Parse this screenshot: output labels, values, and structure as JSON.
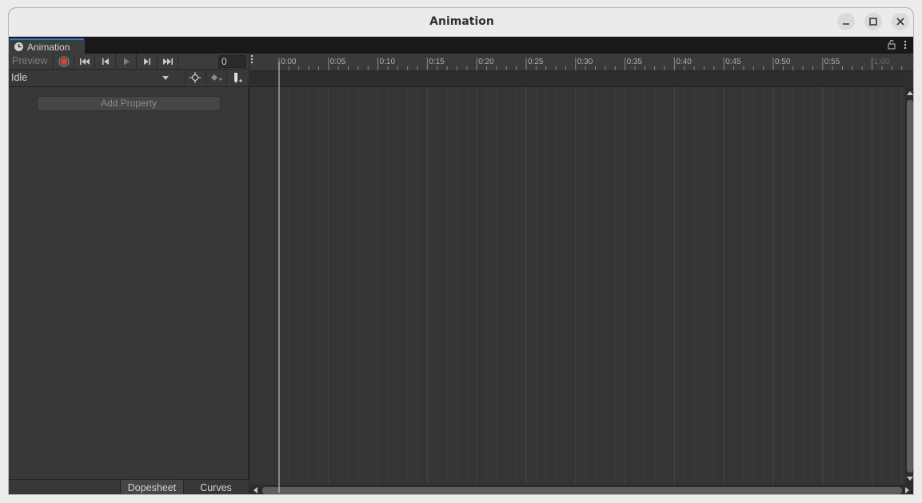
{
  "window": {
    "title": "Animation",
    "controls": [
      "minimize-icon",
      "maximize-icon",
      "close-icon"
    ]
  },
  "tab": {
    "label": "Animation",
    "icon": "clock-icon",
    "actions": [
      "lock-icon",
      "kebab-menu-icon"
    ]
  },
  "toolbar": {
    "preview_label": "Preview",
    "buttons": [
      "record-icon",
      "first-keyframe-icon",
      "previous-keyframe-icon",
      "play-icon",
      "next-keyframe-icon",
      "last-keyframe-icon"
    ],
    "frame_value": "0",
    "record_color": "#c8453a"
  },
  "clip": {
    "selected": "Idle",
    "buttons": [
      "filter-by-selection-icon",
      "add-keyframe-icon",
      "add-event-icon"
    ]
  },
  "property_panel": {
    "add_property_label": "Add Property"
  },
  "view_tabs": [
    {
      "label": "Dopesheet",
      "active": true
    },
    {
      "label": "Curves",
      "active": false
    }
  ],
  "timeline": {
    "ruler_labels": [
      "0:00",
      "0:05",
      "0:10",
      "0:15",
      "0:20",
      "0:25",
      "0:30",
      "0:35",
      "0:40",
      "0:45",
      "0:50",
      "0:55",
      "1:00"
    ],
    "current_frame": 0,
    "playhead_color": "#d8d8d8"
  }
}
